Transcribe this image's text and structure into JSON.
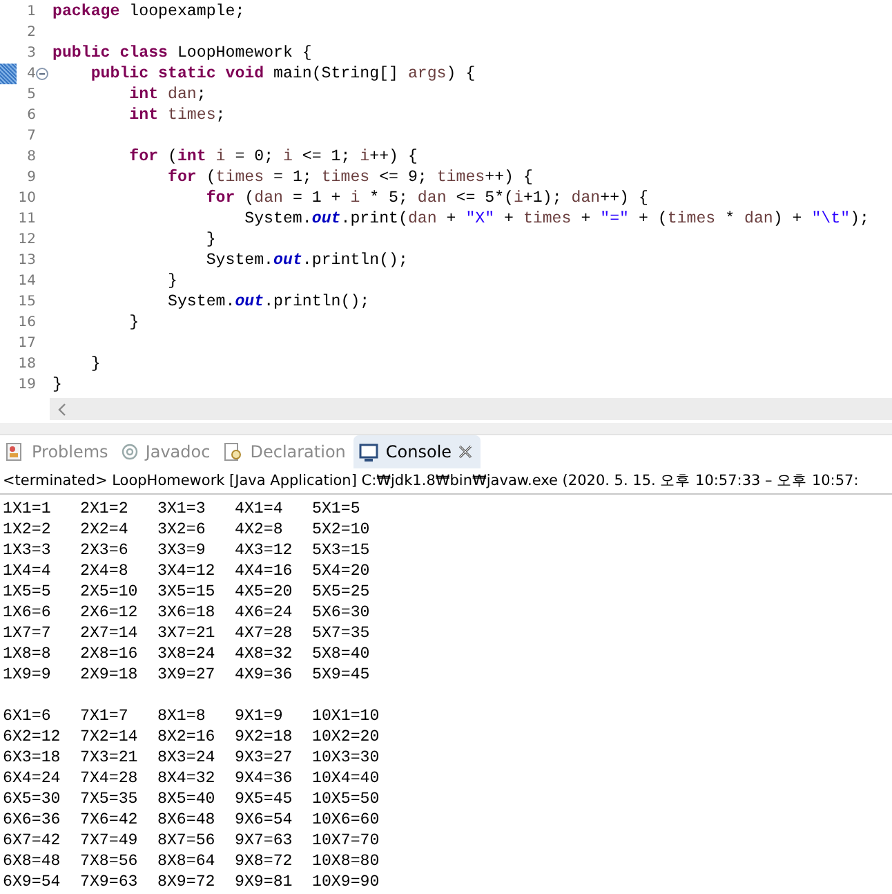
{
  "editor": {
    "lines": [
      {
        "n": "1",
        "marked": false,
        "foldable": false,
        "tokens": [
          {
            "kind": "kw",
            "text": "package"
          },
          {
            "kind": "text",
            "text": " loopexample;"
          }
        ]
      },
      {
        "n": "2",
        "marked": false,
        "foldable": false
      },
      {
        "n": "3",
        "marked": false,
        "foldable": false,
        "tokens": [
          {
            "kind": "kw",
            "text": "public class"
          },
          {
            "kind": "text",
            "text": " LoopHomework {"
          }
        ]
      },
      {
        "n": "4",
        "marked": true,
        "foldable": true,
        "tokens": [
          {
            "kind": "kw",
            "text": "    public static void"
          },
          {
            "kind": "text",
            "text": " main(String[] "
          },
          {
            "kind": "var",
            "text": "args"
          },
          {
            "kind": "text",
            "text": ") {"
          }
        ]
      },
      {
        "n": "5",
        "marked": false,
        "foldable": false,
        "tokens": [
          {
            "kind": "kw",
            "text": "        int"
          },
          {
            "kind": "var",
            "text": " dan"
          },
          {
            "kind": "text",
            "text": ";"
          }
        ]
      },
      {
        "n": "6",
        "marked": false,
        "foldable": false,
        "tokens": [
          {
            "kind": "kw",
            "text": "        int"
          },
          {
            "kind": "var",
            "text": " times"
          },
          {
            "kind": "text",
            "text": ";"
          }
        ]
      },
      {
        "n": "7",
        "marked": false,
        "foldable": false
      },
      {
        "n": "8",
        "marked": false,
        "foldable": false,
        "tokens": [
          {
            "kind": "kw",
            "text": "        for"
          },
          {
            "kind": "text",
            "text": " ("
          },
          {
            "kind": "kw",
            "text": "int"
          },
          {
            "kind": "var",
            "text": " i"
          },
          {
            "kind": "text",
            "text": " = 0; "
          },
          {
            "kind": "var",
            "text": "i"
          },
          {
            "kind": "text",
            "text": " <= 1; "
          },
          {
            "kind": "var",
            "text": "i"
          },
          {
            "kind": "text",
            "text": "++) {"
          }
        ]
      },
      {
        "n": "9",
        "marked": false,
        "foldable": false,
        "tokens": [
          {
            "kind": "kw",
            "text": "            for"
          },
          {
            "kind": "text",
            "text": " ("
          },
          {
            "kind": "var",
            "text": "times"
          },
          {
            "kind": "text",
            "text": " = 1; "
          },
          {
            "kind": "var",
            "text": "times"
          },
          {
            "kind": "text",
            "text": " <= 9; "
          },
          {
            "kind": "var",
            "text": "times"
          },
          {
            "kind": "text",
            "text": "++) {"
          }
        ]
      },
      {
        "n": "10",
        "marked": false,
        "foldable": false,
        "tokens": [
          {
            "kind": "kw",
            "text": "                for"
          },
          {
            "kind": "text",
            "text": " ("
          },
          {
            "kind": "var",
            "text": "dan"
          },
          {
            "kind": "text",
            "text": " = 1 + "
          },
          {
            "kind": "var",
            "text": "i"
          },
          {
            "kind": "text",
            "text": " * 5; "
          },
          {
            "kind": "var",
            "text": "dan"
          },
          {
            "kind": "text",
            "text": " <= 5*("
          },
          {
            "kind": "var",
            "text": "i"
          },
          {
            "kind": "text",
            "text": "+1); "
          },
          {
            "kind": "var",
            "text": "dan"
          },
          {
            "kind": "text",
            "text": "++) {"
          }
        ]
      },
      {
        "n": "11",
        "marked": false,
        "foldable": false,
        "tokens": [
          {
            "kind": "text",
            "text": "                    System."
          },
          {
            "kind": "field",
            "text": "out"
          },
          {
            "kind": "text",
            "text": ".print("
          },
          {
            "kind": "var",
            "text": "dan"
          },
          {
            "kind": "text",
            "text": " + "
          },
          {
            "kind": "str",
            "text": "\"X\""
          },
          {
            "kind": "text",
            "text": " + "
          },
          {
            "kind": "var",
            "text": "times"
          },
          {
            "kind": "text",
            "text": " + "
          },
          {
            "kind": "str",
            "text": "\"=\""
          },
          {
            "kind": "text",
            "text": " + ("
          },
          {
            "kind": "var",
            "text": "times"
          },
          {
            "kind": "text",
            "text": " * "
          },
          {
            "kind": "var",
            "text": "dan"
          },
          {
            "kind": "text",
            "text": ") + "
          },
          {
            "kind": "str",
            "text": "\"\\t\""
          },
          {
            "kind": "text",
            "text": ");"
          }
        ]
      },
      {
        "n": "12",
        "marked": false,
        "foldable": false,
        "tokens": [
          {
            "kind": "text",
            "text": "                }"
          }
        ]
      },
      {
        "n": "13",
        "marked": false,
        "foldable": false,
        "tokens": [
          {
            "kind": "text",
            "text": "                System."
          },
          {
            "kind": "field",
            "text": "out"
          },
          {
            "kind": "text",
            "text": ".println();"
          }
        ]
      },
      {
        "n": "14",
        "marked": false,
        "foldable": false,
        "tokens": [
          {
            "kind": "text",
            "text": "            }"
          }
        ]
      },
      {
        "n": "15",
        "marked": false,
        "foldable": false,
        "tokens": [
          {
            "kind": "text",
            "text": "            System."
          },
          {
            "kind": "field",
            "text": "out"
          },
          {
            "kind": "text",
            "text": ".println();"
          }
        ]
      },
      {
        "n": "16",
        "marked": false,
        "foldable": false,
        "tokens": [
          {
            "kind": "text",
            "text": "        }"
          }
        ]
      },
      {
        "n": "17",
        "marked": false,
        "foldable": false
      },
      {
        "n": "18",
        "marked": false,
        "foldable": false,
        "tokens": [
          {
            "kind": "text",
            "text": "    }"
          }
        ]
      },
      {
        "n": "19",
        "marked": false,
        "foldable": false,
        "tokens": [
          {
            "kind": "text",
            "text": "}"
          }
        ]
      }
    ]
  },
  "tabs": [
    {
      "kind": "problems",
      "label": "Problems",
      "selected": false
    },
    {
      "kind": "javadoc",
      "label": "Javadoc",
      "selected": false
    },
    {
      "kind": "declaration",
      "label": "Declaration",
      "selected": false
    },
    {
      "kind": "console",
      "label": "Console",
      "selected": true
    }
  ],
  "console": {
    "status": "<terminated> LoopHomework [Java Application] C:₩jdk1.8₩bin₩javaw.exe  (2020. 5. 15. 오후 10:57:33 – 오후 10:57:",
    "output_blocks": [
      [
        [
          "1X1=1",
          "2X1=2",
          "3X1=3",
          "4X1=4",
          "5X1=5"
        ],
        [
          "1X2=2",
          "2X2=4",
          "3X2=6",
          "4X2=8",
          "5X2=10"
        ],
        [
          "1X3=3",
          "2X3=6",
          "3X3=9",
          "4X3=12",
          "5X3=15"
        ],
        [
          "1X4=4",
          "2X4=8",
          "3X4=12",
          "4X4=16",
          "5X4=20"
        ],
        [
          "1X5=5",
          "2X5=10",
          "3X5=15",
          "4X5=20",
          "5X5=25"
        ],
        [
          "1X6=6",
          "2X6=12",
          "3X6=18",
          "4X6=24",
          "5X6=30"
        ],
        [
          "1X7=7",
          "2X7=14",
          "3X7=21",
          "4X7=28",
          "5X7=35"
        ],
        [
          "1X8=8",
          "2X8=16",
          "3X8=24",
          "4X8=32",
          "5X8=40"
        ],
        [
          "1X9=9",
          "2X9=18",
          "3X9=27",
          "4X9=36",
          "5X9=45"
        ]
      ],
      [
        [
          "6X1=6",
          "7X1=7",
          "8X1=8",
          "9X1=9",
          "10X1=10"
        ],
        [
          "6X2=12",
          "7X2=14",
          "8X2=16",
          "9X2=18",
          "10X2=20"
        ],
        [
          "6X3=18",
          "7X3=21",
          "8X3=24",
          "9X3=27",
          "10X3=30"
        ],
        [
          "6X4=24",
          "7X4=28",
          "8X4=32",
          "9X4=36",
          "10X4=40"
        ],
        [
          "6X5=30",
          "7X5=35",
          "8X5=40",
          "9X5=45",
          "10X5=50"
        ],
        [
          "6X6=36",
          "7X6=42",
          "8X6=48",
          "9X6=54",
          "10X6=60"
        ],
        [
          "6X7=42",
          "7X7=49",
          "8X7=56",
          "9X7=63",
          "10X7=70"
        ],
        [
          "6X8=48",
          "7X8=56",
          "8X8=64",
          "9X8=72",
          "10X8=80"
        ],
        [
          "6X9=54",
          "7X9=63",
          "8X9=72",
          "9X9=81",
          "10X9=90"
        ]
      ]
    ]
  }
}
